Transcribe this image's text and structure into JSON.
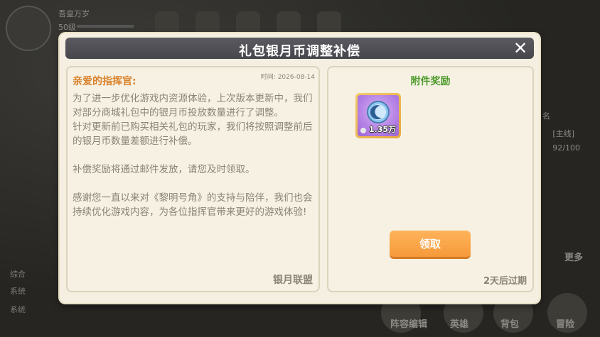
{
  "background": {
    "player_name": "吾皇万岁",
    "level_label": "50级",
    "side_tags": [
      "名",
      "[主线]",
      "92/100"
    ],
    "chat_lines": [
      "综合",
      "系统",
      "系统"
    ],
    "bottom_labels": [
      "阵容编辑",
      "英雄",
      "背包",
      "冒险"
    ],
    "more_label": "更多"
  },
  "dialog": {
    "title": "礼包银月币调整补偿",
    "close_icon": "close-icon"
  },
  "mail": {
    "greeting": "亲爱的指挥官:",
    "timestamp": "时间: 2026-08-14",
    "body": "为了进一步优化游戏内资源体验，上次版本更新中，我们对部分商城礼包中的银月币投放数量进行了调整。\n针对更新前已购买相关礼包的玩家，我们将按照调整前后的银月币数量差额进行补偿。\n\n补偿奖励将通过邮件发放，请您及时领取。\n\n感谢您一直以来对《黎明号角》的支持与陪伴，我们也会持续优化游戏内容，为各位指挥官带来更好的游戏体验!",
    "sender": "银月联盟"
  },
  "attachments": {
    "title": "附件奖励",
    "items": [
      {
        "icon": "silver-moon-coin-icon",
        "quantity": "1.35万",
        "colors": {
          "frame": "#f2c96a",
          "bg": "#b784e6"
        }
      }
    ],
    "claim_label": "领取",
    "expiry": "2天后过期"
  },
  "colors": {
    "accent_orange": "#f59a3a",
    "greeting": "#d9822b",
    "attach_title": "#4c9a2a",
    "title_bar": "#505056"
  }
}
